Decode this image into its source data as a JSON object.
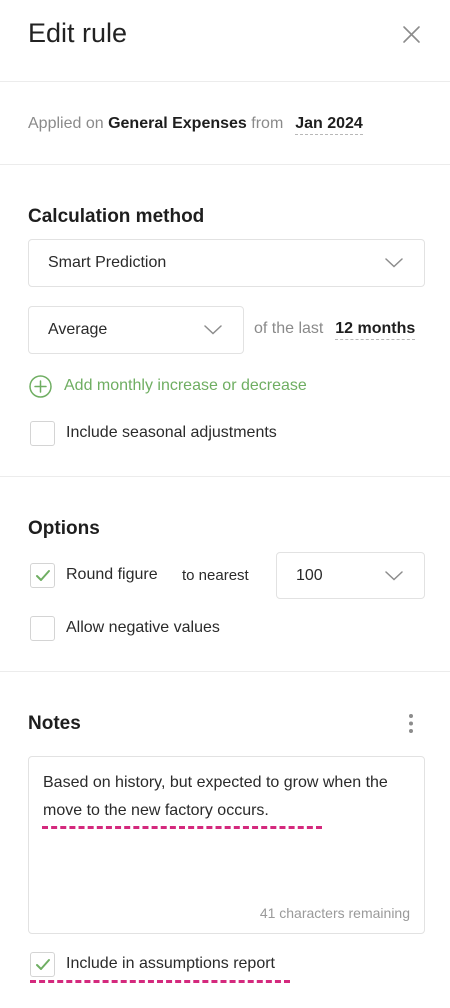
{
  "header": {
    "title": "Edit rule"
  },
  "applied": {
    "prefix": "Applied on",
    "account": "General Expenses",
    "from_label": "from",
    "date": "Jan 2024"
  },
  "calculation": {
    "title": "Calculation method",
    "method_value": "Smart Prediction",
    "aggregate_value": "Average",
    "of_last_label": "of the last",
    "period": "12 months",
    "add_label": "Add monthly increase or decrease",
    "seasonal_label": "Include seasonal adjustments",
    "seasonal_checked": false
  },
  "options": {
    "title": "Options",
    "round_label": "Round figure",
    "round_checked": true,
    "to_nearest_label": "to nearest",
    "nearest_value": "100",
    "negative_label": "Allow negative values",
    "negative_checked": false
  },
  "notes": {
    "title": "Notes",
    "text": "Based on history, but expected to grow when the move to the new factory occurs.",
    "remaining": "41 characters remaining",
    "include_label": "Include in assumptions report",
    "include_checked": true
  },
  "colors": {
    "accent_green": "#6fae62",
    "highlight_pink": "#d4297d",
    "divider": "#ececec"
  },
  "icons": {
    "close": "close-icon",
    "chevron": "chevron-down-icon",
    "add": "plus-circle-icon",
    "check": "check-icon",
    "menu": "more-vertical-icon"
  }
}
